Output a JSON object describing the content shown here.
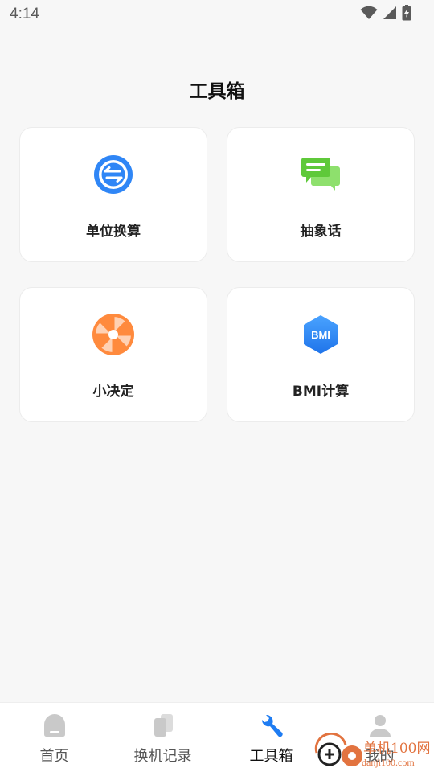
{
  "status_bar": {
    "time": "4:14"
  },
  "page": {
    "title": "工具箱"
  },
  "tools": [
    {
      "label": "单位换算",
      "icon": "unit-convert-icon",
      "color": "#2f86f6"
    },
    {
      "label": "抽象话",
      "icon": "chat-bubbles-icon",
      "color": "#6cd14b"
    },
    {
      "label": "小决定",
      "icon": "spinner-wheel-icon",
      "color": "#ff8a3d"
    },
    {
      "label": "BMI计算",
      "icon": "bmi-hexagon-icon",
      "color": "#2f86f6",
      "badge": "BMI"
    }
  ],
  "bottom_nav": [
    {
      "label": "首页",
      "icon": "home-icon",
      "active": false
    },
    {
      "label": "换机记录",
      "icon": "phones-icon",
      "active": false
    },
    {
      "label": "工具箱",
      "icon": "wrench-icon",
      "active": true
    },
    {
      "label": "我的",
      "icon": "profile-icon",
      "active": false
    }
  ],
  "watermark": {
    "text": "单机100网",
    "url": "danji100.com"
  },
  "colors": {
    "accent": "#1e7cf2",
    "inactive_icon": "#c9c9c9",
    "background": "#f7f7f7"
  }
}
